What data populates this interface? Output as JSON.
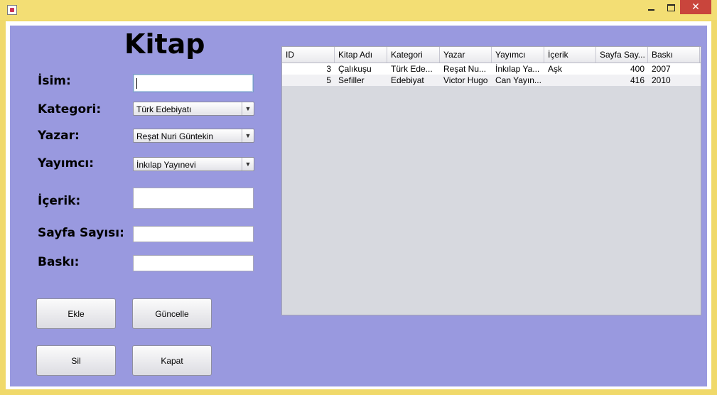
{
  "window": {
    "minimize": "–",
    "maximize": "□",
    "close": "✕"
  },
  "form": {
    "title": "Kitap",
    "labels": {
      "isim": "İsim:",
      "kategori": "Kategori:",
      "yazar": "Yazar:",
      "yayimci": "Yayımcı:",
      "icerik": "İçerik:",
      "sayfa_sayisi": "Sayfa Sayısı:",
      "baski": "Baskı:"
    },
    "values": {
      "isim": "",
      "kategori": "Türk Edebiyatı",
      "yazar": "Reşat Nuri Güntekin",
      "yayimci": "İnkılap Yayınevi",
      "icerik": "",
      "sayfa_sayisi": "",
      "baski": ""
    },
    "buttons": {
      "ekle": "Ekle",
      "guncelle": "Güncelle",
      "sil": "Sil",
      "kapat": "Kapat"
    }
  },
  "table": {
    "columns": [
      "ID",
      "Kitap Adı",
      "Kategori",
      "Yazar",
      "Yayımcı",
      "İçerik",
      "Sayfa Say...",
      "Baskı"
    ],
    "rows": [
      [
        "3",
        "Çalıkuşu",
        "Türk Ede...",
        "Reşat Nu...",
        "İnkılap Ya...",
        "Aşk",
        "400",
        "2007"
      ],
      [
        "5",
        "Sefiller",
        "Edebiyat",
        "Victor Hugo",
        "Can Yayın...",
        "",
        "416",
        "2010"
      ]
    ]
  }
}
